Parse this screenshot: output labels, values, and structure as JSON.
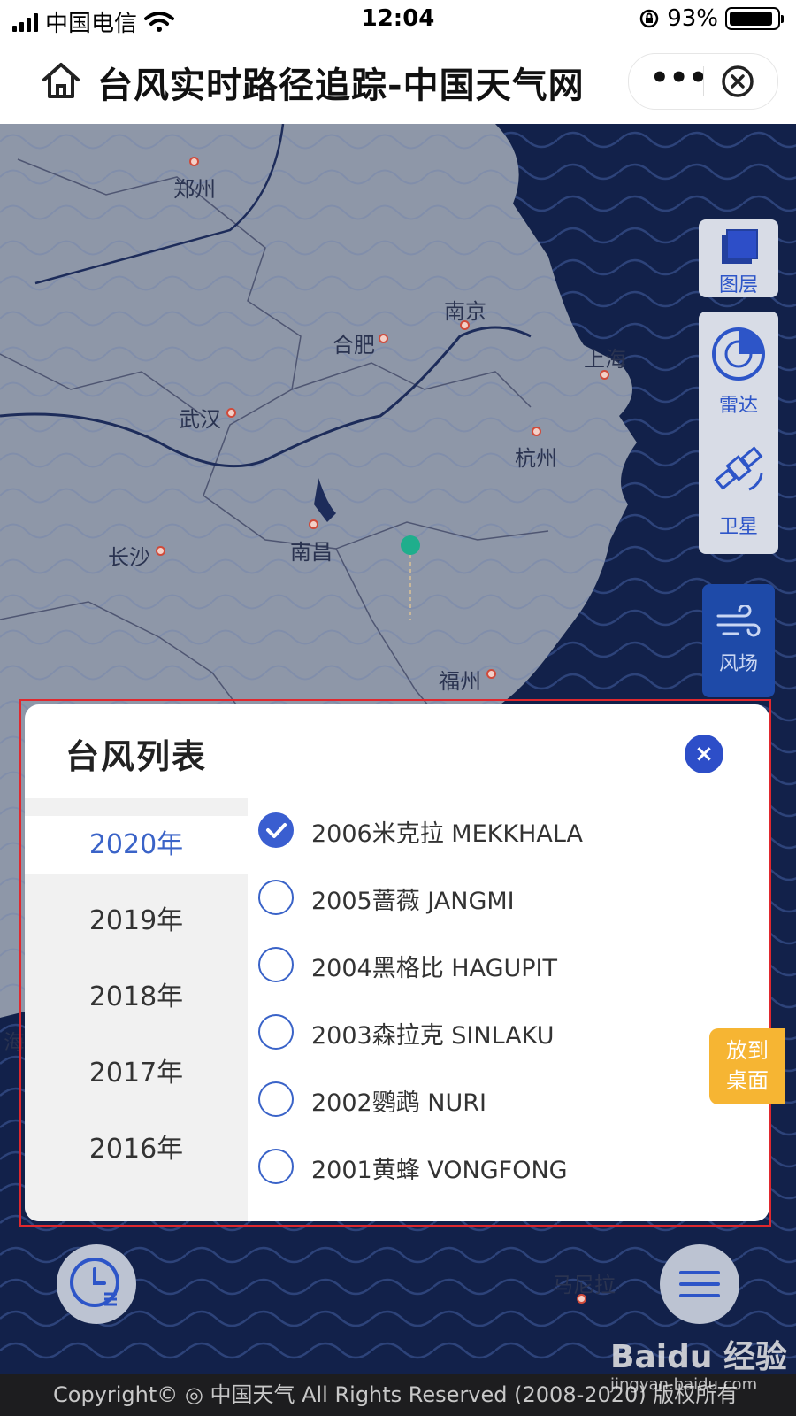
{
  "status_bar": {
    "carrier": "中国电信",
    "time": "12:04",
    "battery": "93%",
    "battery_level": 0.93
  },
  "nav": {
    "title": "台风实时路径追踪-中国天气网",
    "more": "•••"
  },
  "map": {
    "cities": [
      "郑州",
      "南京",
      "合肥",
      "上海",
      "武汉",
      "杭州",
      "长沙",
      "南昌",
      "福州",
      "马尼拉",
      "海"
    ]
  },
  "tools": {
    "layers": "图层",
    "radar": "雷达",
    "satellite": "卫星",
    "wind": "风场"
  },
  "typhoon_list": {
    "title": "台风列表",
    "close": "×",
    "years": [
      "2020年",
      "2019年",
      "2018年",
      "2017年",
      "2016年"
    ],
    "selected_year": "2020年",
    "typhoons": [
      {
        "name": "2006米克拉 MEKKHALA",
        "checked": true
      },
      {
        "name": "2005蔷薇 JANGMI",
        "checked": false
      },
      {
        "name": "2004黑格比 HAGUPIT",
        "checked": false
      },
      {
        "name": "2003森拉克 SINLAKU",
        "checked": false
      },
      {
        "name": "2002鹦鹉 NURI",
        "checked": false
      },
      {
        "name": "2001黄蜂 VONGFONG",
        "checked": false
      }
    ]
  },
  "desktop_badge": {
    "line1": "放到",
    "line2": "桌面"
  },
  "footer": {
    "text": "Copyright© ◎ 中国天气 All Rights Reserved (2008-2020) 版权所有"
  },
  "watermark": {
    "main": "Baidu 经验",
    "sub": "jingyan.baidu.com"
  },
  "colors": {
    "accent": "#2d4ec8",
    "badge": "#f6b533",
    "ocean": "#0f1b3d",
    "land": "#8e97a8"
  }
}
